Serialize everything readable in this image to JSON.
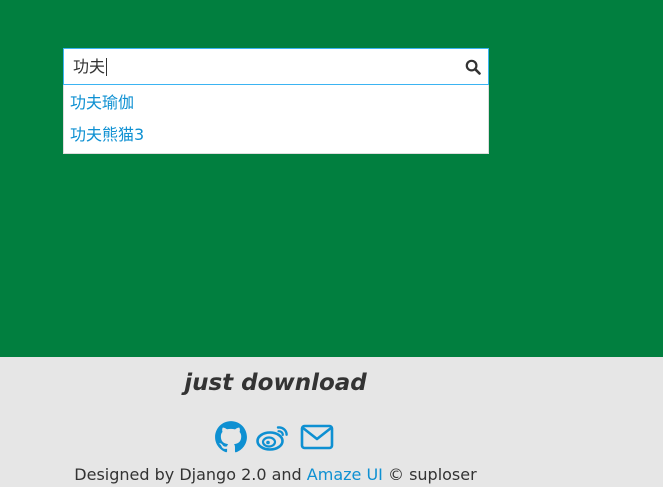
{
  "search": {
    "value": "功夫",
    "suggestions": [
      "功夫瑜伽",
      "功夫熊猫3"
    ]
  },
  "footer": {
    "title": "just download",
    "icons": [
      "github-icon",
      "weibo-icon",
      "email-icon"
    ],
    "credit_prefix": "Designed by Django 2.0 and ",
    "credit_link": "Amaze UI",
    "credit_suffix": " © suploser"
  },
  "colors": {
    "hero_bg": "#017f3f",
    "footer_bg": "#e6e6e6",
    "accent": "#0e90d2",
    "search_border": "#3bb4f2"
  }
}
